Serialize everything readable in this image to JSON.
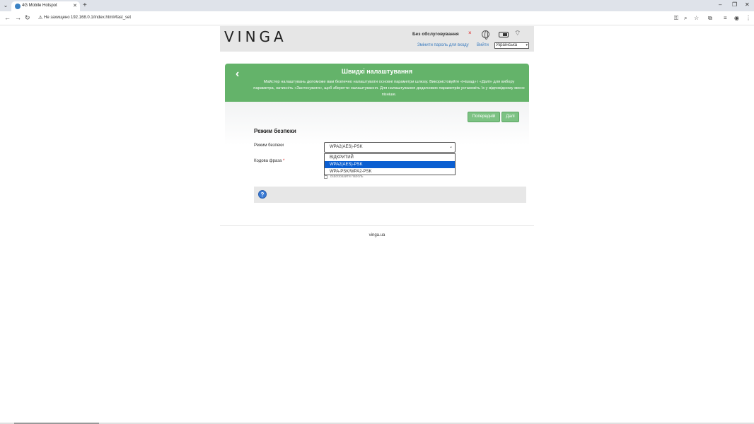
{
  "browser": {
    "tab_title": "4G Mobile Hotspot",
    "security_warning": "Не захищено",
    "url": "192.168.0.1/index.html#fast_set"
  },
  "header": {
    "logo": "VINGA",
    "service_status": "Без обслуговування",
    "status_mark": "×",
    "change_password_link": "Змінити пароль для входу",
    "logout_link": "Вийти",
    "language": "Українська"
  },
  "wizard": {
    "title": "Швидкі налаштування",
    "description": "Майстер налаштувань допоможе вам безпечно налаштувати основні параметри шлюзу. Використовуйте «Назад» і «Далі» для вибору параметра, натисніть «Застосувати», щоб зберегти налаштування. Для налаштування додаткових параметрів установіть їх у відповідному меню пізніше.",
    "prev_button": "Попередній",
    "next_button": "Далі",
    "section_title": "Режим безпеки",
    "mode_label": "Режим безпеки",
    "passphrase_label": "Кодова фраза",
    "required_mark": "*",
    "selected_mode": "WPA2(AES)-PSK",
    "mode_options": [
      "ВІДКРИТИЙ",
      "WPA2(AES)-PSK",
      "WPA-PSK/WPA2-PSK"
    ],
    "show_password_label": "Відобразити пароль",
    "help_symbol": "?"
  },
  "footer": {
    "site": "vinga.ua"
  }
}
